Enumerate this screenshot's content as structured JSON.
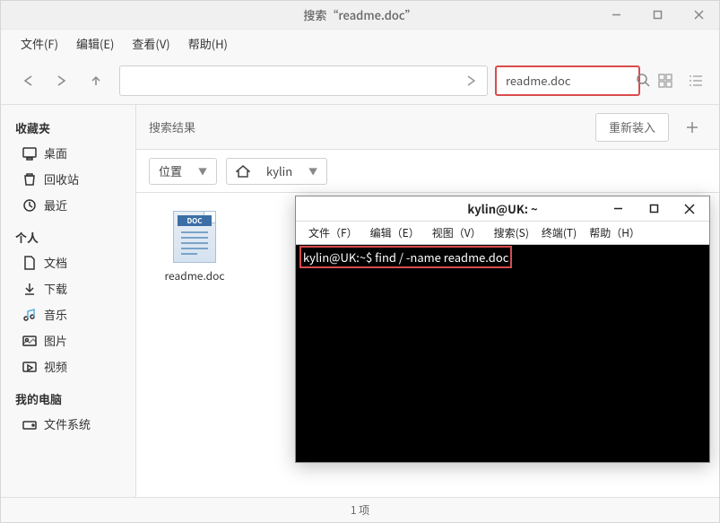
{
  "fm": {
    "title": "搜索“readme.doc”",
    "menu": {
      "file": "文件(F)",
      "edit": "编辑(E)",
      "view": "查看(V)",
      "help": "帮助(H)"
    },
    "search_value": "readme.doc",
    "sidebar": {
      "favorites_heading": "收藏夹",
      "favorites": [
        {
          "icon": "desktop",
          "label": "桌面"
        },
        {
          "icon": "trash",
          "label": "回收站"
        },
        {
          "icon": "recent",
          "label": "最近"
        }
      ],
      "personal_heading": "个人",
      "personal": [
        {
          "icon": "documents",
          "label": "文档"
        },
        {
          "icon": "downloads",
          "label": "下载"
        },
        {
          "icon": "music",
          "label": "音乐"
        },
        {
          "icon": "pictures",
          "label": "图片"
        },
        {
          "icon": "videos",
          "label": "视频"
        }
      ],
      "computer_heading": "我的电脑",
      "computer": [
        {
          "icon": "filesystem",
          "label": "文件系统"
        }
      ]
    },
    "main": {
      "results_label": "搜索结果",
      "reload_label": "重新装入",
      "location_dropdown": "位置",
      "path_dropdown": "kylin",
      "file": {
        "badge": "DOC",
        "name": "readme.doc"
      }
    },
    "status": "1 项"
  },
  "term": {
    "title": "kylin@UK: ~",
    "menu": {
      "file": "文件（F）",
      "edit": "编辑（E）",
      "view": "视图（V）",
      "search": "搜索(S)",
      "terminal": "终端(T)",
      "help": "帮助（H）"
    },
    "prompt": "kylin@UK:~$ ",
    "command": "find / -name readme.doc"
  },
  "colors": {
    "highlight": "#d94c4c"
  }
}
